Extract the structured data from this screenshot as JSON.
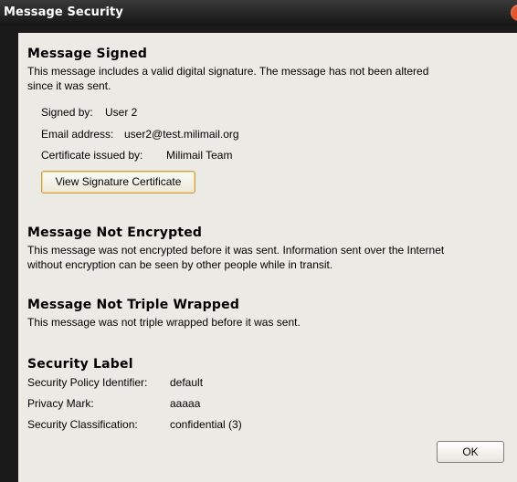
{
  "window": {
    "title": "Message Security"
  },
  "signed": {
    "heading": "Message Signed",
    "description_line1": "This message includes a valid digital signature. The message has not been altered",
    "description_line2": "since it was sent.",
    "signed_by_label": "Signed by:",
    "signed_by_value": "User 2",
    "email_label": "Email address:",
    "email_value": "user2@test.milimail.org",
    "issuer_label": "Certificate issued by:",
    "issuer_value": "Milimail Team",
    "view_cert_label": "View Signature Certificate"
  },
  "encrypted": {
    "heading": "Message Not Encrypted",
    "description_line1": "This message was not encrypted before it was sent. Information sent over the Internet",
    "description_line2": "without encryption can be seen by other people while in transit."
  },
  "wrapped": {
    "heading": "Message Not Triple Wrapped",
    "description": "This message was not triple wrapped before it was sent."
  },
  "label": {
    "heading": "Security Label",
    "policy_label": "Security Policy Identifier:",
    "policy_value": "default",
    "privacy_label": "Privacy Mark:",
    "privacy_value": "aaaaa",
    "classification_label": "Security Classification:",
    "classification_value": "confidential (3)"
  },
  "buttons": {
    "ok_label": "OK"
  }
}
